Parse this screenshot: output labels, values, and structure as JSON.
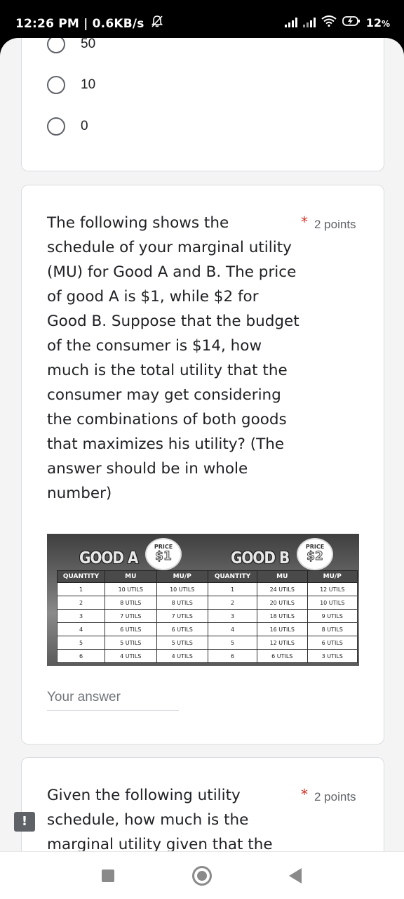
{
  "status": {
    "time_speed": "12:26 PM | 0.6KB/s",
    "battery": "12"
  },
  "prev_question": {
    "options": [
      "50",
      "10",
      "0"
    ]
  },
  "question1": {
    "text": "The following shows the schedule of your marginal utility (MU) for Good A and B. The price of good A is $1, while $2 for Good B. Suppose that the budget of the consumer is $14, how much is the total utility that the consumer may get considering the combinations of both goods that maximizes his utility? (The answer should be in whole number)",
    "required_mark": "*",
    "points": "2 points",
    "answer_placeholder": "Your answer",
    "table": {
      "good_a_title": "GOOD A",
      "good_b_title": "GOOD B",
      "price_label": "PRICE",
      "price_a": "$1",
      "price_b": "$2",
      "headers": [
        "QUANTITY",
        "MU",
        "MU/P"
      ],
      "good_a_rows": [
        [
          "1",
          "10 UTILS",
          "10 UTILS"
        ],
        [
          "2",
          "8 UTILS",
          "8 UTILS"
        ],
        [
          "3",
          "7 UTILS",
          "7 UTILS"
        ],
        [
          "4",
          "6 UTILS",
          "6 UTILS"
        ],
        [
          "5",
          "5 UTILS",
          "5 UTILS"
        ],
        [
          "6",
          "4 UTILS",
          "4 UTILS"
        ]
      ],
      "good_b_rows": [
        [
          "1",
          "24 UTILS",
          "12 UTILS"
        ],
        [
          "2",
          "20 UTILS",
          "10 UTILS"
        ],
        [
          "3",
          "18 UTILS",
          "9 UTILS"
        ],
        [
          "4",
          "16 UTILS",
          "8 UTILS"
        ],
        [
          "5",
          "12 UTILS",
          "6 UTILS"
        ],
        [
          "6",
          "6 UTILS",
          "3 UTILS"
        ]
      ]
    }
  },
  "question2": {
    "text": "Given the following utility schedule, how much is the marginal utility given that the",
    "required_mark": "*",
    "points": "2 points"
  },
  "feedback_icon": "!"
}
